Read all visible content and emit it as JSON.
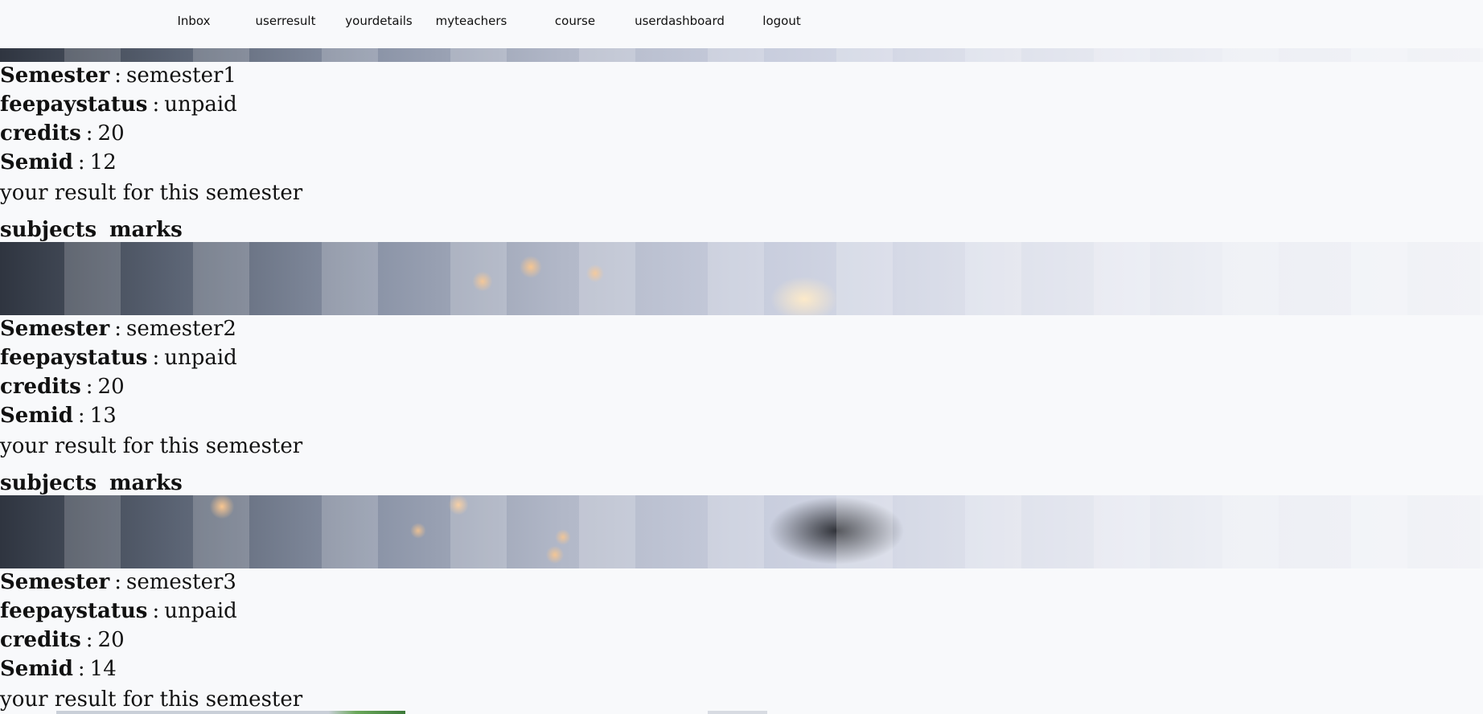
{
  "nav": {
    "inbox": "Inbox",
    "userresult": "userresult",
    "yourdetails": "yourdetails",
    "myteachers": "myteachers",
    "course": "course",
    "userdashboard": "userdashboard",
    "logout": "logout"
  },
  "labels": {
    "semester": "Semester",
    "feepaystatus": "feepaystatus",
    "credits": "credits",
    "semid": "Semid",
    "separator": ":",
    "result_text": "your result for this semester",
    "subjects": "subjects",
    "marks": "marks"
  },
  "semesters": [
    {
      "semester": "semester1",
      "feepaystatus": "unpaid",
      "credits": "20",
      "semid": "12"
    },
    {
      "semester": "semester2",
      "feepaystatus": "unpaid",
      "credits": "20",
      "semid": "13"
    },
    {
      "semester": "semester3",
      "feepaystatus": "unpaid",
      "credits": "20",
      "semid": "14"
    }
  ]
}
